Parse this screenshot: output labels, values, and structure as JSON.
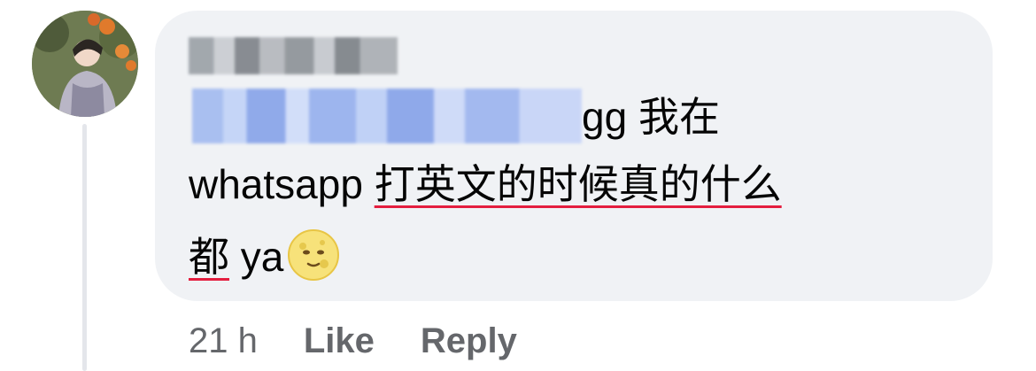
{
  "comment": {
    "text_line1_suffix": "gg 我在",
    "text_line2_plain": "whatsapp ",
    "text_line2_underlined": "打英文的时候真的什么",
    "text_line3_underlined": "都",
    "text_line3_plain": " ya",
    "emoji": "full-moon-face"
  },
  "actions": {
    "timestamp": "21 h",
    "like_label": "Like",
    "reply_label": "Reply"
  },
  "colors": {
    "bubble": "#f0f2f5",
    "text": "#050505",
    "meta": "#65676b",
    "spell_underline": "#e41e3f"
  }
}
